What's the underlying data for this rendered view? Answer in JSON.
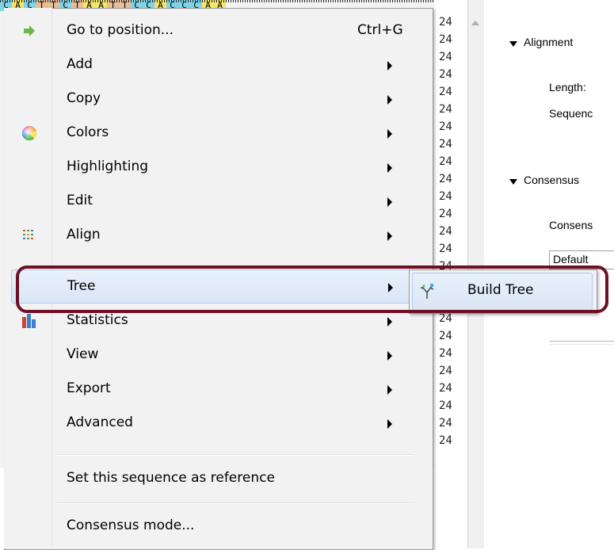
{
  "sequence": {
    "visible_letters": [
      "C",
      "A",
      "C",
      "T",
      "T",
      "C",
      "T",
      "A",
      "A",
      "T",
      "T",
      "C",
      "C",
      "A",
      "C",
      "C",
      "C",
      "A",
      "A"
    ],
    "colors": {
      "A": "#f5e66b",
      "C": "#7fd4e8",
      "T": "#e8bd97",
      "G": "#b6e08a"
    }
  },
  "row_numbers": [
    "24",
    "24",
    "24",
    "24",
    "24",
    "24",
    "24",
    "24",
    "24",
    "24",
    "24",
    "24",
    "24",
    "24",
    "24",
    "24",
    "24",
    "24",
    "24",
    "24",
    "24",
    "24",
    "24",
    "24",
    "24"
  ],
  "panel": {
    "alignment_header": "Alignment",
    "length_label": "Length:",
    "sequences_label": "Sequenc",
    "consensus_header": "Consensus",
    "consensus_label": "Consens",
    "combo_value": "Default"
  },
  "menu": {
    "items": [
      {
        "label": "Go to position...",
        "shortcut": "Ctrl+G",
        "icon": "arrow-right-icon",
        "submenu": false
      },
      {
        "label": "Add",
        "submenu": true
      },
      {
        "label": "Copy",
        "submenu": true
      },
      {
        "label": "Colors",
        "icon": "color-wheel-icon",
        "submenu": true
      },
      {
        "label": "Highlighting",
        "submenu": true
      },
      {
        "label": "Edit",
        "submenu": true
      },
      {
        "label": "Align",
        "icon": "align-icon",
        "submenu": true
      },
      {
        "label": "Tree",
        "submenu": true,
        "highlighted": true
      },
      {
        "label": "Statistics",
        "icon": "statistics-icon",
        "submenu": true
      },
      {
        "label": "View",
        "submenu": true
      },
      {
        "label": "Export",
        "submenu": true
      },
      {
        "label": "Advanced",
        "submenu": true
      }
    ],
    "set_reference": "Set this sequence as reference",
    "consensus_mode": "Consensus mode..."
  },
  "submenu": {
    "build_tree": "Build Tree",
    "icon": "tree-icon"
  },
  "accent": {
    "highlight": "#dbe6f5",
    "annotation": "#6e1024"
  }
}
